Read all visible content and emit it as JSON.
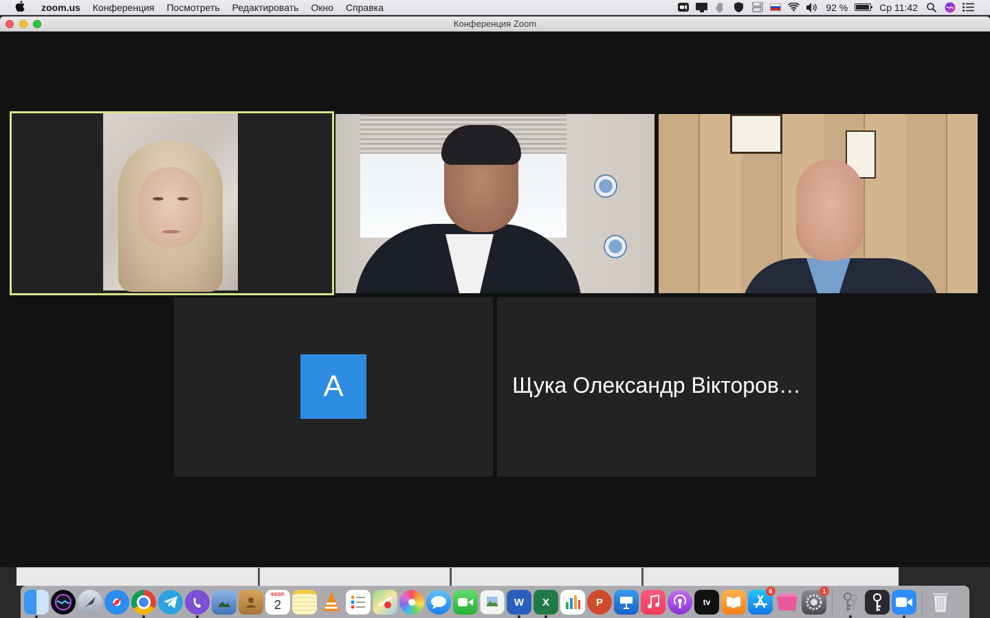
{
  "menubar": {
    "app_name": "zoom.us",
    "menus": [
      "Конференция",
      "Посмотреть",
      "Редактировать",
      "Окно",
      "Справка"
    ],
    "battery_percent": "92 %",
    "battery_level": 0.92,
    "clock": "Ср 11:42"
  },
  "window": {
    "title": "Конференция Zoom"
  },
  "participants": {
    "avatar_letter": "A",
    "name_tile": "Щука Олександр Вікторов…"
  },
  "dock": {
    "calendar_month": "ФЕВР.",
    "calendar_day": "2",
    "excel_letter": "X",
    "word_letter": "W",
    "powerpoint_letter": "P",
    "appletv_label": "tv",
    "appstore_badge": "6",
    "preferences_badge": "1"
  },
  "colors": {
    "active_speaker_border": "#d6e58a",
    "avatar_bg": "#2d8ce2",
    "tile_bg": "#232323",
    "stage_bg": "#121212"
  }
}
